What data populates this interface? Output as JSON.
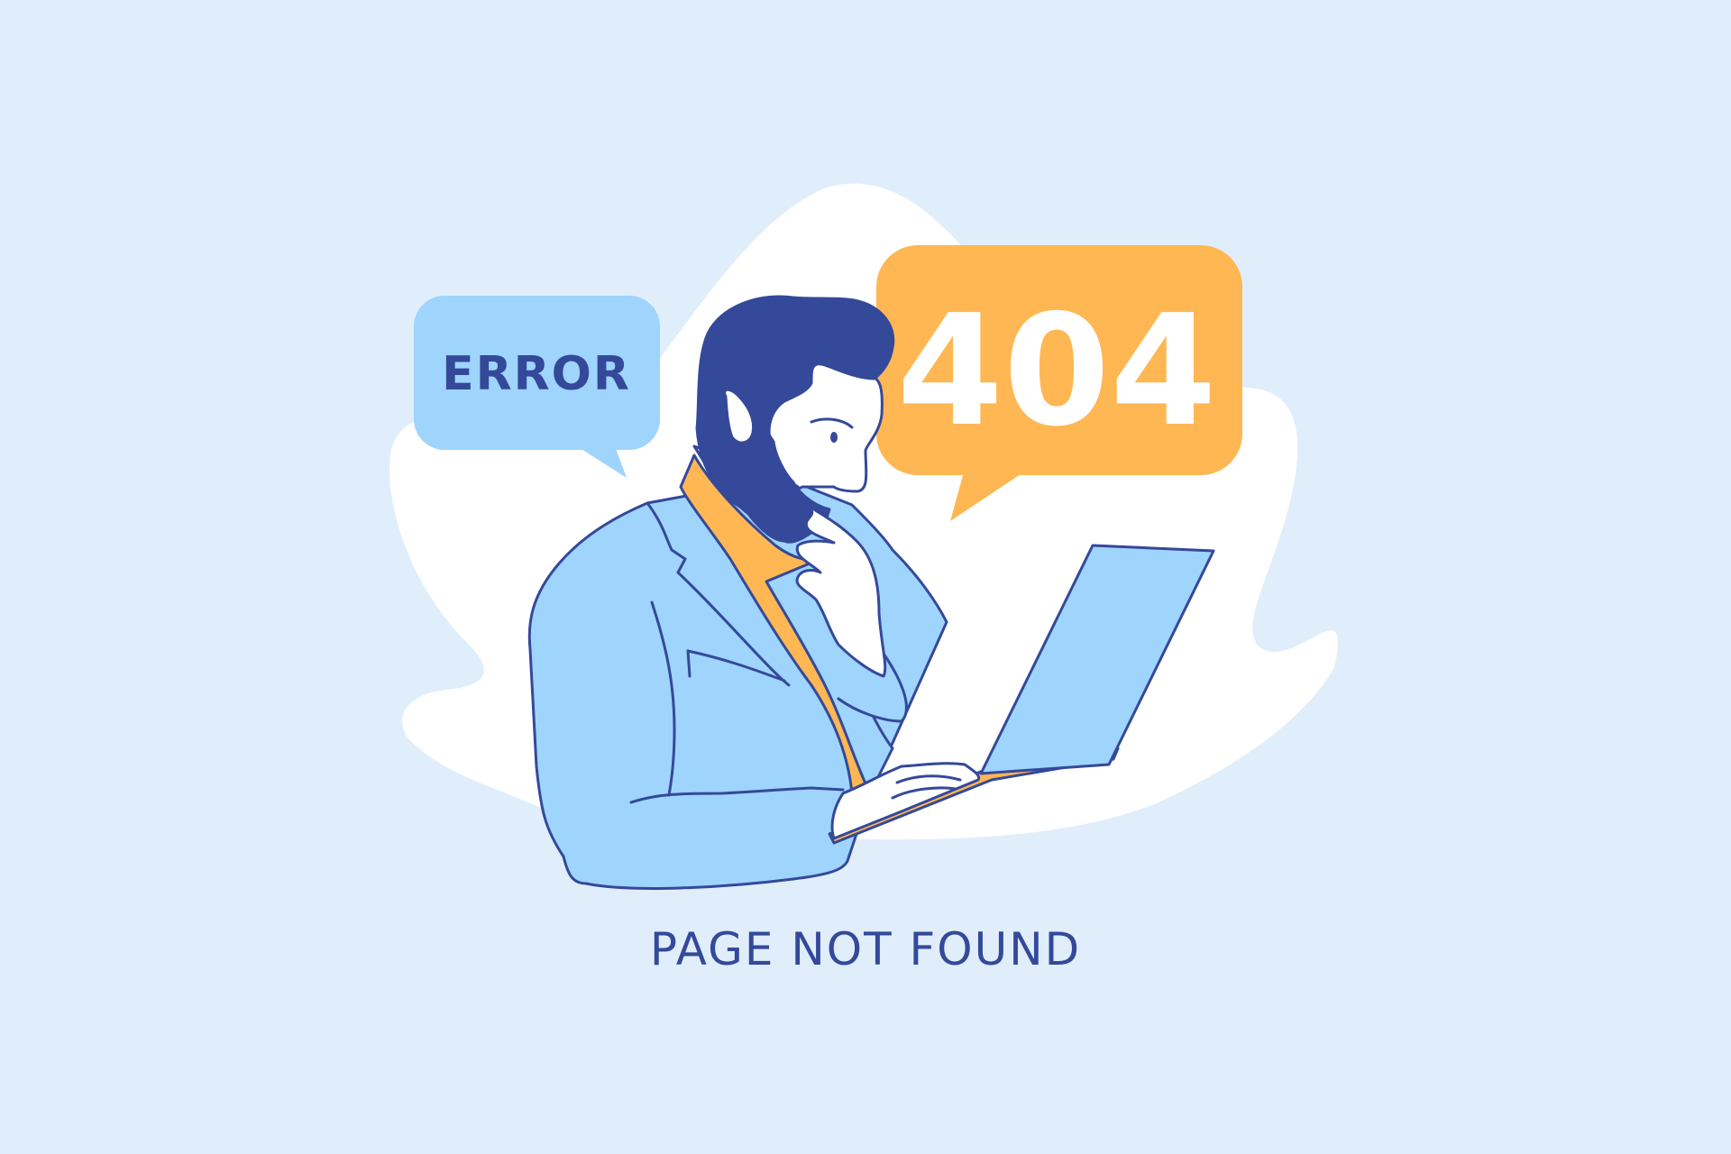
{
  "error_bubble": {
    "label": "ERROR"
  },
  "code_bubble": {
    "label": "404"
  },
  "caption": "PAGE NOT FOUND",
  "colors": {
    "background": "#e0eefb",
    "blob": "#ffffff",
    "navy": "#34499a",
    "light_blue": "#9fd4fd",
    "orange": "#ffb753",
    "skin": "#ffffff"
  },
  "illustration": {
    "figure": "man-with-beard",
    "device": "laptop",
    "pose": "hand-on-chin-thinking"
  }
}
